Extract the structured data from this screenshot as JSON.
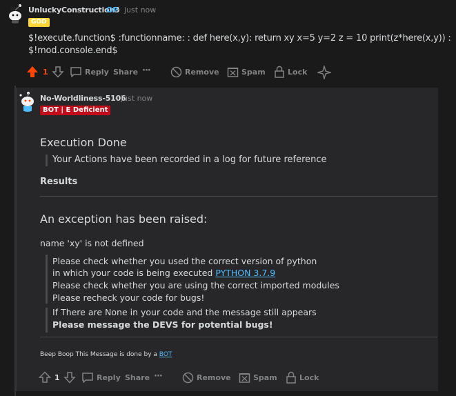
{
  "comment1": {
    "username": "UnluckyConstruction3",
    "op_label": "OP",
    "separator": "·",
    "time": "just now",
    "flair": "GOD",
    "body_line1": "$!execute.function$ :functionname: : def here(x,y): return xy x=5 y=2 z = 10 print(z*here(x,y)) :",
    "body_line2": "$!mod.console.end$",
    "vote_count": "1",
    "actions": {
      "reply": "Reply",
      "share": "Share",
      "more": "···",
      "remove": "Remove",
      "spam": "Spam",
      "lock": "Lock"
    }
  },
  "comment2": {
    "username": "No-Worldliness-5106",
    "separator": "·",
    "time": "just now",
    "flair": "BOT | E Deficient",
    "heading": "Execution Done",
    "quote": "Your Actions have been recorded in a log for future reference",
    "results_label": "Results",
    "exception_heading": "An exception has been raised:",
    "error_line": "name 'xy' is not defined",
    "notes": {
      "line1": "Please check whether you used the correct version of python",
      "line2_prefix": "in which your code is being executed ",
      "line2_link": "PYTHON 3.7.9",
      "line3": "Please check whether you are using the correct imported modules",
      "line4": "Please recheck your code for bugs!",
      "line5": "If There are None in your code and the message still appears",
      "line6": "Please message the DEVS for potential bugs!"
    },
    "footer_prefix": "Beep Boop This Message is done by a ",
    "footer_link": "BOT",
    "vote_count": "1",
    "actions": {
      "reply": "Reply",
      "share": "Share",
      "more": "···",
      "remove": "Remove",
      "spam": "Spam",
      "lock": "Lock"
    }
  },
  "colors": {
    "upvote_active": "#ff4500",
    "op": "#4fbcff",
    "flair_god": "#ffd635",
    "flair_bot": "#c20c1a",
    "link": "#4fbcff"
  }
}
